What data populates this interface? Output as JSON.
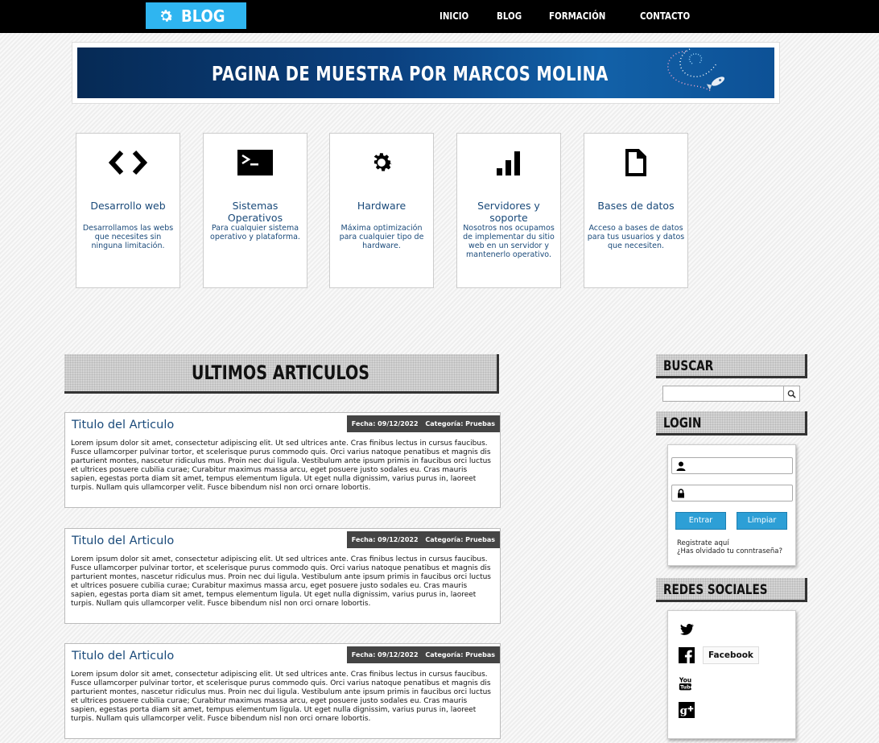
{
  "navbar": {
    "logo_text": "BLOG",
    "links": [
      "INICIO",
      "BLOG",
      "FORMACIÓN",
      "CONTACTO"
    ]
  },
  "banner": {
    "title": "PAGINA DE MUESTRA POR MARCOS MOLINA"
  },
  "features": [
    {
      "icon": "code-icon",
      "title": "Desarrollo web",
      "description": "Desarrollamos las webs que necesites sin ninguna limitación."
    },
    {
      "icon": "terminal-icon",
      "title": "Sistemas Operativos",
      "description": "Para cualquier sistema operativo y plataforma."
    },
    {
      "icon": "gear-icon",
      "title": "Hardware",
      "description": "Máxima optimización para cualquier tipo de hardware."
    },
    {
      "icon": "signal-bars-icon",
      "title": "Servidores y soporte",
      "description": "Nosotros nos ocupamos de implementar du sitio web en un servidor y mantenerlo operativo."
    },
    {
      "icon": "document-icon",
      "title": "Bases de datos",
      "description": "Acceso a bases de datos para tus usuarios y datos que necesiten."
    }
  ],
  "main": {
    "heading": "ULTIMOS ARTICULOS",
    "articles": [
      {
        "title": "Titulo del Articulo",
        "date": "Fecha: 09/12/2022",
        "category": "Categoría: Pruebas",
        "body": "Lorem ipsum dolor sit amet, consectetur adipiscing elit. Ut sed ultrices ante. Cras finibus lectus in cursus faucibus. Fusce ullamcorper pulvinar tortor, et scelerisque purus commodo quis. Orci varius natoque penatibus et magnis dis parturient montes, nascetur ridiculus mus. Proin nec dui ligula. Vestibulum ante ipsum primis in faucibus orci luctus et ultrices posuere cubilia curae; Curabitur maximus massa arcu, eget posuere justo sodales eu. Cras mauris sapien, egestas porta diam sit amet, tempus elementum ligula. Ut eget nulla dignissim, varius purus in, laoreet turpis. Nullam quis ullamcorper velit. Fusce bibendum nisl non orci ornare lobortis."
      },
      {
        "title": "Titulo del Articulo",
        "date": "Fecha: 09/12/2022",
        "category": "Categoría: Pruebas",
        "body": "Lorem ipsum dolor sit amet, consectetur adipiscing elit. Ut sed ultrices ante. Cras finibus lectus in cursus faucibus. Fusce ullamcorper pulvinar tortor, et scelerisque purus commodo quis. Orci varius natoque penatibus et magnis dis parturient montes, nascetur ridiculus mus. Proin nec dui ligula. Vestibulum ante ipsum primis in faucibus orci luctus et ultrices posuere cubilia curae; Curabitur maximus massa arcu, eget posuere justo sodales eu. Cras mauris sapien, egestas porta diam sit amet, tempus elementum ligula. Ut eget nulla dignissim, varius purus in, laoreet turpis. Nullam quis ullamcorper velit. Fusce bibendum nisl non orci ornare lobortis."
      },
      {
        "title": "Titulo del Articulo",
        "date": "Fecha: 09/12/2022",
        "category": "Categoría: Pruebas",
        "body": "Lorem ipsum dolor sit amet, consectetur adipiscing elit. Ut sed ultrices ante. Cras finibus lectus in cursus faucibus. Fusce ullamcorper pulvinar tortor, et scelerisque purus commodo quis. Orci varius natoque penatibus et magnis dis parturient montes, nascetur ridiculus mus. Proin nec dui ligula. Vestibulum ante ipsum primis in faucibus orci luctus et ultrices posuere cubilia curae; Curabitur maximus massa arcu, eget posuere justo sodales eu. Cras mauris sapien, egestas porta diam sit amet, tempus elementum ligula. Ut eget nulla dignissim, varius purus in, laoreet turpis. Nullam quis ullamcorper velit. Fusce bibendum nisl non orci ornare lobortis."
      }
    ]
  },
  "sidebar": {
    "search_heading": "BUSCAR",
    "search_value": "",
    "login_heading": "LOGIN",
    "login": {
      "user_value": "",
      "password_value": "",
      "submit_label": "Entrar",
      "clear_label": "Limpiar",
      "register_link": "Registrate aquí",
      "forgot_link": "¿Has olvidado tu conntraseña?"
    },
    "social_heading": "REDES SOCIALES",
    "social": {
      "icons": [
        "twitter-icon",
        "facebook-icon",
        "youtube-icon",
        "google-plus-icon"
      ],
      "facebook_label": "Facebook"
    }
  },
  "colors": {
    "nav_bg": "#000000",
    "logo_bg": "#2fb5f0",
    "link_blue": "#1a4a7a",
    "button_blue": "#2d9fd6",
    "meta_bg": "#444444"
  }
}
